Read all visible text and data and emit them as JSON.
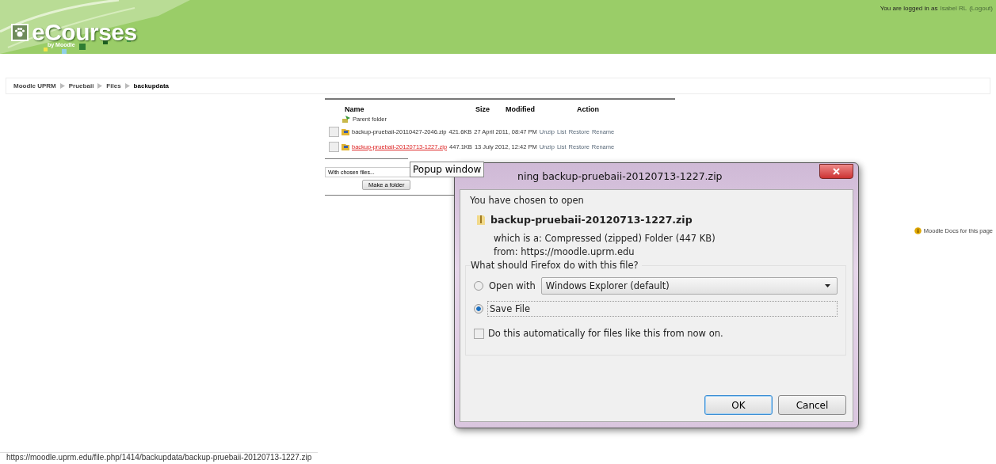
{
  "header": {
    "logo": {
      "title": "eCourses",
      "subtitle": "by Moodle"
    },
    "login": {
      "prefix": "You are logged in as",
      "user": "Isabel RL",
      "logout": "(Logout)"
    }
  },
  "breadcrumb": [
    "Moodle UPRM",
    "Pruebaii",
    "Files",
    "backupdata"
  ],
  "files": {
    "columns": [
      "Name",
      "Size",
      "Modified",
      "Action"
    ],
    "parent": "Parent folder",
    "rows": [
      {
        "name": "backup-pruebaii-20110427-2046.zip",
        "size": "421.6KB",
        "modified": "27 April 2011, 08:47 PM",
        "actions": [
          "Unzip",
          "List",
          "Restore",
          "Rename"
        ],
        "checked": false,
        "highlighted": false
      },
      {
        "name": "backup-pruebaii-20120713-1227.zip",
        "size": "447.1KB",
        "modified": "13 July 2012, 12:42 PM",
        "actions": [
          "Unzip",
          "List",
          "Restore",
          "Rename"
        ],
        "checked": false,
        "highlighted": true
      }
    ],
    "chosen_select": "With chosen files...",
    "make_folder": "Make a folder"
  },
  "tooltip": "Popup window",
  "docs_link": "Moodle Docs for this page",
  "status_url": "https://moodle.uprm.edu/file.php/1414/backupdata/backup-pruebaii-20120713-1227.zip",
  "dialog": {
    "title": "ning backup-pruebaii-20120713-1227.zip",
    "intro": "You have chosen to open",
    "filename": "backup-pruebaii-20120713-1227.zip",
    "type": "which is a: Compressed (zipped) Folder (447 KB)",
    "from": "from: https://moodle.uprm.edu",
    "question": "What should Firefox do with this file?",
    "options": [
      {
        "kind": "app",
        "label": "Open with",
        "app": "Windows Explorer (default)",
        "selected": false
      },
      {
        "kind": "plain",
        "label": "Save File",
        "selected": true
      }
    ],
    "remember": {
      "label": "Do this automatically for files like this from now on.",
      "checked": false
    },
    "buttons": [
      {
        "label": "OK",
        "default": true
      },
      {
        "label": "Cancel",
        "default": false
      }
    ]
  }
}
